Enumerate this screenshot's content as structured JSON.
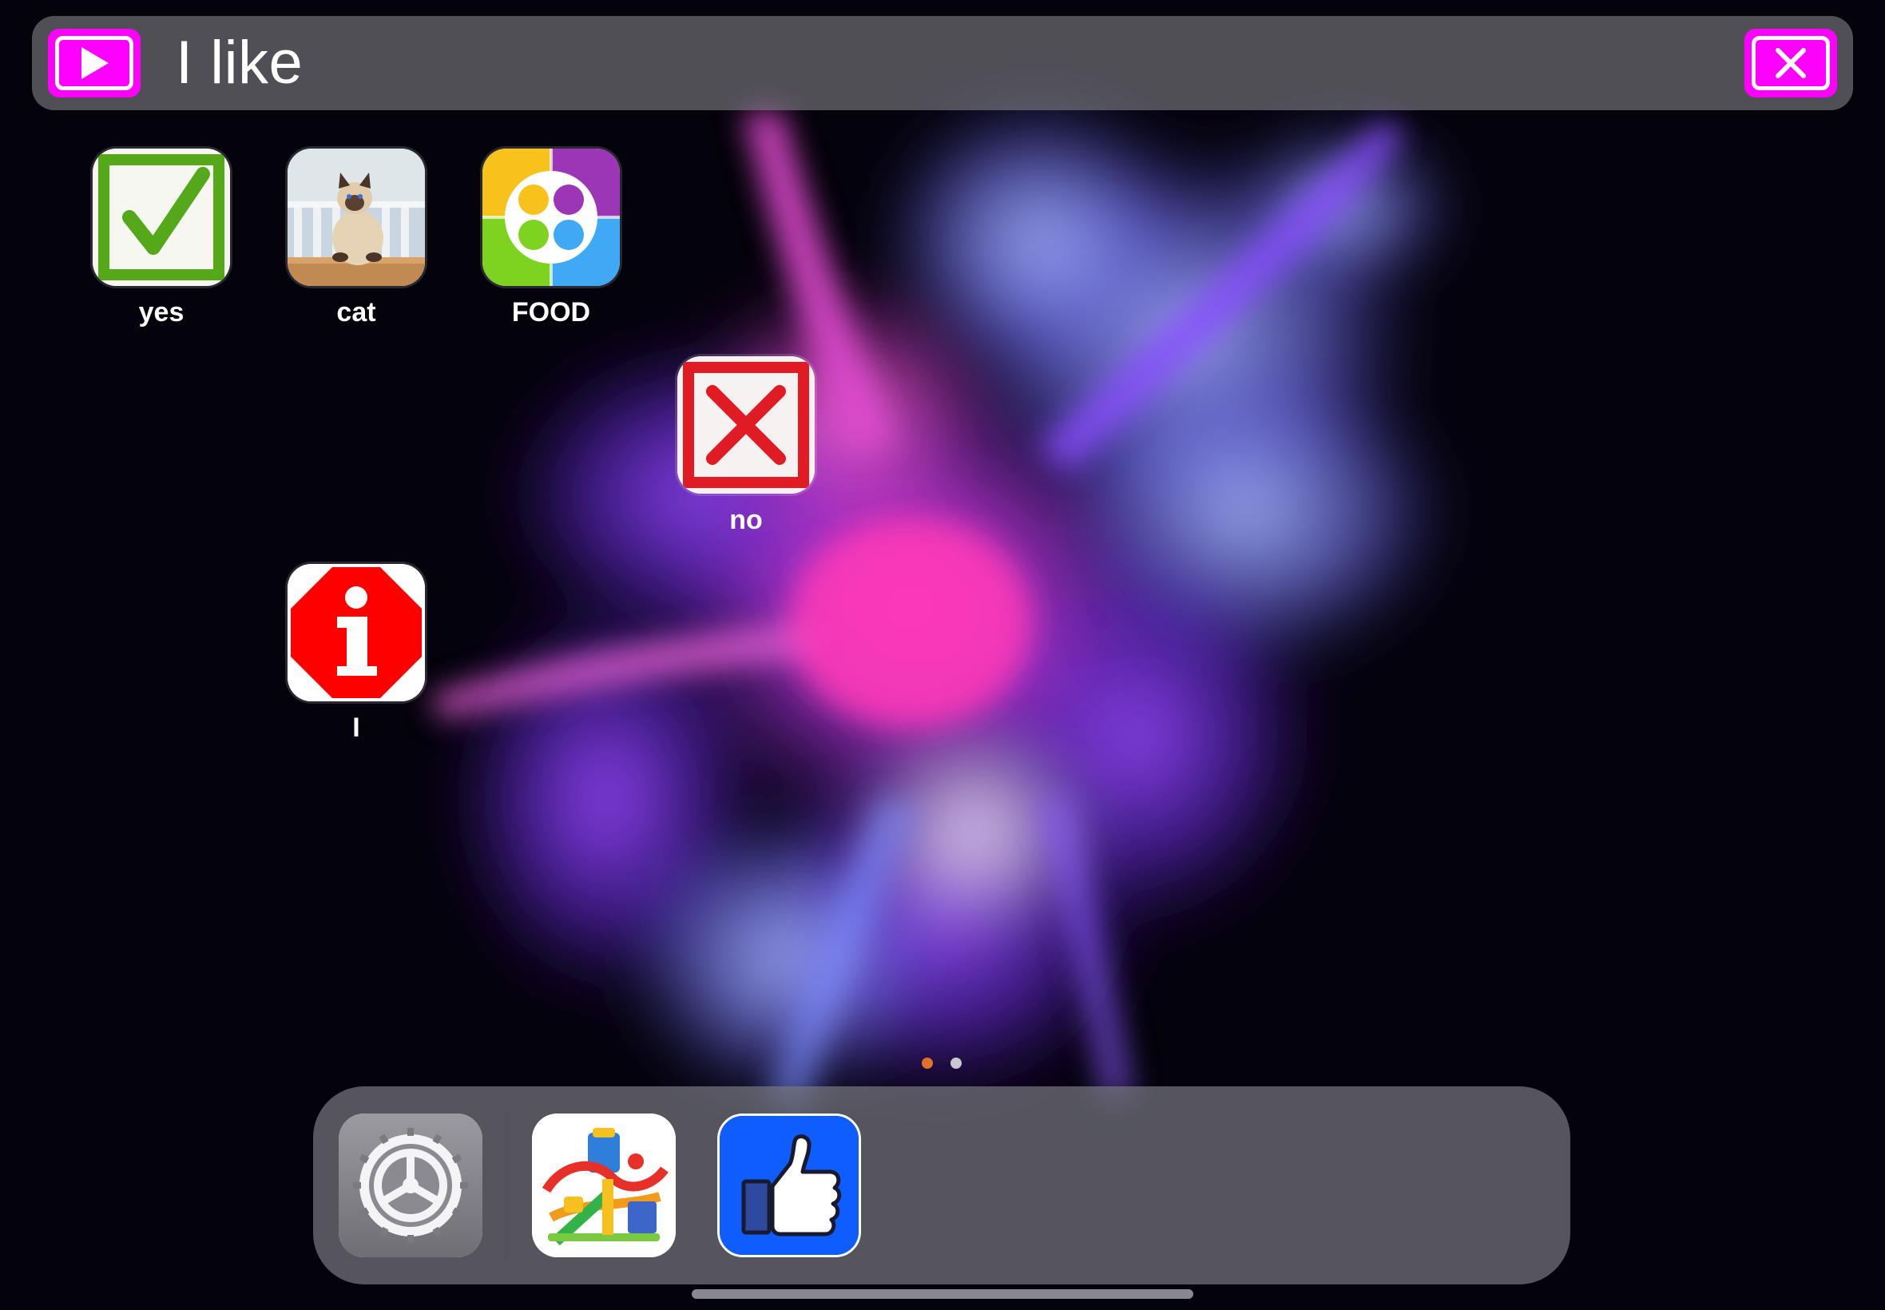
{
  "sentence_bar": {
    "text": "I like",
    "play_icon": "play-icon",
    "clear_icon": "close-icon",
    "button_color": "#ff00ff"
  },
  "apps": [
    {
      "id": "yes",
      "label": "yes",
      "icon": "checkmark-icon"
    },
    {
      "id": "cat",
      "label": "cat",
      "icon": "cat-photo"
    },
    {
      "id": "food",
      "label": "FOOD",
      "icon": "color-circles-icon"
    },
    {
      "id": "no",
      "label": "no",
      "icon": "cross-icon"
    },
    {
      "id": "i",
      "label": "I",
      "icon": "info-icon"
    }
  ],
  "page_indicator": {
    "pages": 2,
    "current": 1,
    "active_color": "#e0702a",
    "inactive_color": "#c8c8d0"
  },
  "dock": {
    "apps": [
      {
        "id": "settings",
        "icon": "gear-icon"
      },
      {
        "id": "toy",
        "icon": "toy-track-image"
      },
      {
        "id": "like",
        "icon": "thumbs-up-icon",
        "color": "#0f5cff"
      }
    ]
  }
}
